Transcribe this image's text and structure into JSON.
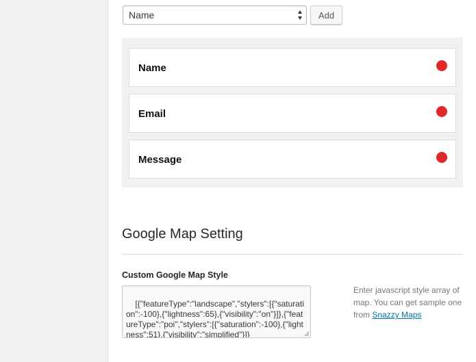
{
  "field_selector": {
    "selected_value": "Name",
    "add_label": "Add"
  },
  "fields": [
    {
      "label": "Name"
    },
    {
      "label": "Email"
    },
    {
      "label": "Message"
    }
  ],
  "map_setting": {
    "section_title": "Google Map Setting",
    "style_label": "Custom Google Map Style",
    "style_value": "[{\"featureType\":\"landscape\",\"stylers\":[{\"saturation\":-100},{\"lightness\":65},{\"visibility\":\"on\"}]},{\"featureType\":\"poi\",\"stylers\":[{\"saturation\":-100},{\"lightness\":51},{\"visibility\":\"simplified\"}]}",
    "help_text": "Enter javascript style array of map. You can get sample one from ",
    "help_link": "Snazzy Maps"
  },
  "colors": {
    "remove_dot": "#e0282b",
    "link": "#0073aa"
  }
}
